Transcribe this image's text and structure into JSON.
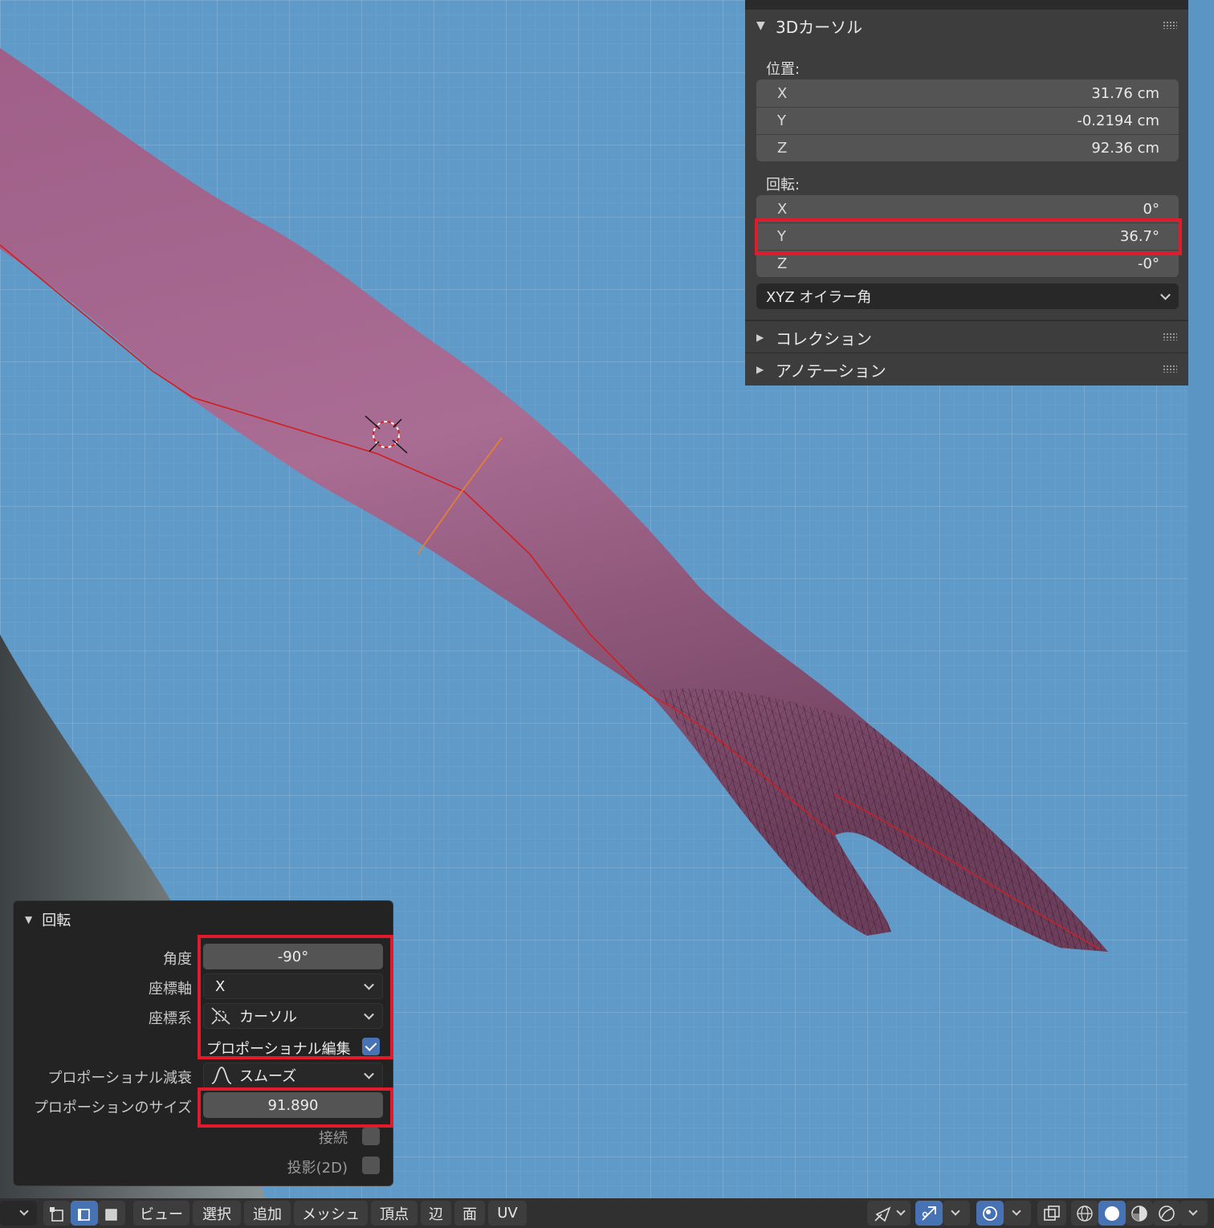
{
  "cursor_panel": {
    "title": "3Dカーソル",
    "location_label": "位置:",
    "location": [
      {
        "axis": "X",
        "value": "31.76 cm"
      },
      {
        "axis": "Y",
        "value": "-0.2194 cm"
      },
      {
        "axis": "Z",
        "value": "92.36 cm"
      }
    ],
    "rotation_label": "回転:",
    "rotation": [
      {
        "axis": "X",
        "value": "0°"
      },
      {
        "axis": "Y",
        "value": "36.7°"
      },
      {
        "axis": "Z",
        "value": "-0°"
      }
    ],
    "rotation_mode": "XYZ オイラー角"
  },
  "collapsed_sections": [
    "コレクション",
    "アノテーション"
  ],
  "operator_panel": {
    "title": "回転",
    "angle_label": "角度",
    "angle_value": "-90°",
    "axis_label": "座標軸",
    "axis_value": "X",
    "orient_label": "座標系",
    "orient_value": "カーソル",
    "proportional_label": "プロポーショナル編集",
    "proportional_checked": true,
    "falloff_label": "プロポーショナル減衰",
    "falloff_value": "スムーズ",
    "size_label": "プロポーションのサイズ",
    "size_value": "91.890",
    "connected_label": "接続",
    "connected_checked": false,
    "projected_label": "投影(2D)",
    "projected_checked": false
  },
  "header_menu": [
    "ビュー",
    "選択",
    "追加",
    "メッシュ",
    "頂点",
    "辺",
    "面",
    "UV"
  ],
  "colors": {
    "highlight_box": "#e01c2c",
    "active_blue": "#4772b3",
    "viewport_bg": "#5f9ac9",
    "mesh_pink": "#a8678f"
  }
}
